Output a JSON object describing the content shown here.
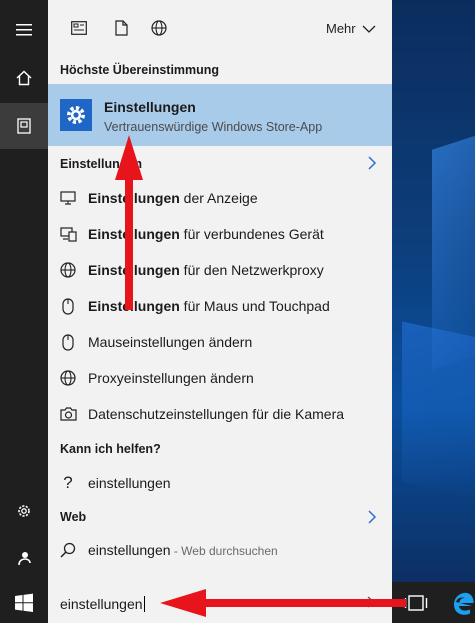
{
  "topbar": {
    "more_label": "Mehr"
  },
  "best_match": {
    "header": "Höchste Übereinstimmung",
    "title": "Einstellungen",
    "subtitle": "Vertrauenswürdige Windows Store-App"
  },
  "settings_section": {
    "header": "Einstellungen",
    "items": [
      {
        "bold": "Einstellungen",
        "rest": " der Anzeige",
        "icon": "monitor-icon"
      },
      {
        "bold": "Einstellungen",
        "rest": " für verbundenes Gerät",
        "icon": "devices-icon"
      },
      {
        "bold": "Einstellungen",
        "rest": " für den Netzwerkproxy",
        "icon": "globe-icon"
      },
      {
        "bold": "Einstellungen",
        "rest": " für Maus und Touchpad",
        "icon": "mouse-icon"
      },
      {
        "bold": "",
        "rest": "Mauseinstellungen ändern",
        "icon": "mouse-icon"
      },
      {
        "bold": "",
        "rest": "Proxyeinstellungen ändern",
        "icon": "globe-icon"
      },
      {
        "bold": "",
        "rest": "Datenschutzeinstellungen für die Kamera",
        "icon": "camera-icon"
      }
    ]
  },
  "help_section": {
    "header": "Kann ich helfen?",
    "item": "einstellungen"
  },
  "web_section": {
    "header": "Web",
    "item": "einstellungen",
    "item_suffix": " - Web durchsuchen"
  },
  "search": {
    "value": "einstellungen"
  }
}
